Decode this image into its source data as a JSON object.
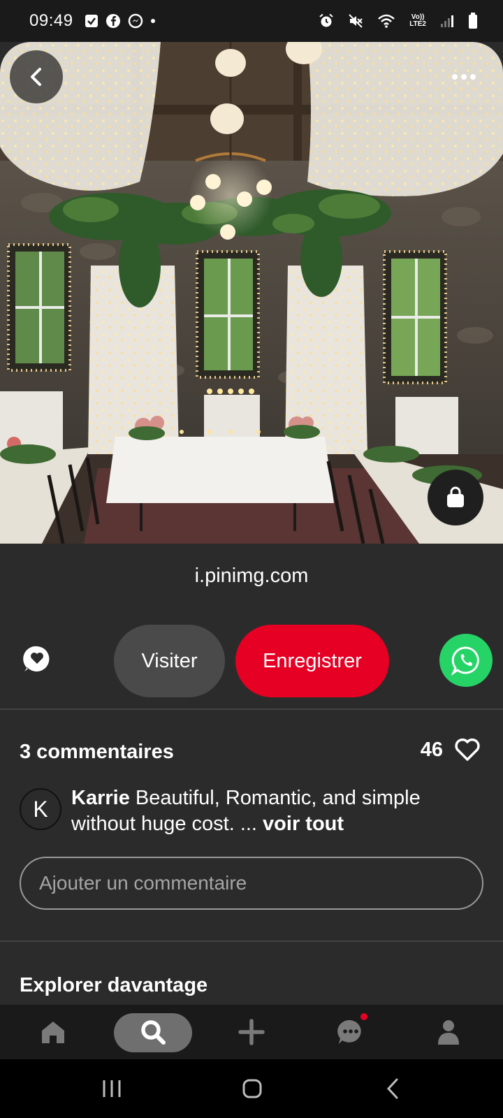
{
  "status_bar": {
    "time": "09:49",
    "left_icons": [
      "checkbox-icon",
      "facebook-icon",
      "messenger-icon",
      "dot-icon"
    ],
    "network_label_top": "Vo))",
    "network_label_bottom": "LTE2",
    "right_icons": [
      "alarm-icon",
      "mute-icon",
      "wifi-icon",
      "signal-icon",
      "battery-icon"
    ]
  },
  "pin": {
    "source": "i.pinimg.com"
  },
  "actions": {
    "visit_label": "Visiter",
    "save_label": "Enregistrer",
    "share_icon": "share-heart-icon",
    "whatsapp_icon": "whatsapp-icon"
  },
  "comments": {
    "title": "3 commentaires",
    "like_count": "46",
    "items": [
      {
        "avatar_letter": "K",
        "author": "Karrie",
        "text": " Beautiful, Romantic, and simple without huge cost. ... ",
        "see_all": "voir tout"
      }
    ],
    "input_placeholder": "Ajouter un commentaire"
  },
  "explore": {
    "title": "Explorer davantage"
  },
  "colors": {
    "background": "#2b2b2b",
    "save_button": "#e60023",
    "visit_button": "#4a4a4a",
    "whatsapp": "#25d366",
    "notification_dot": "#e60023"
  },
  "nav": {
    "items": [
      "home-icon",
      "search-icon",
      "add-icon",
      "messages-icon",
      "profile-icon"
    ],
    "active": "search-icon"
  }
}
